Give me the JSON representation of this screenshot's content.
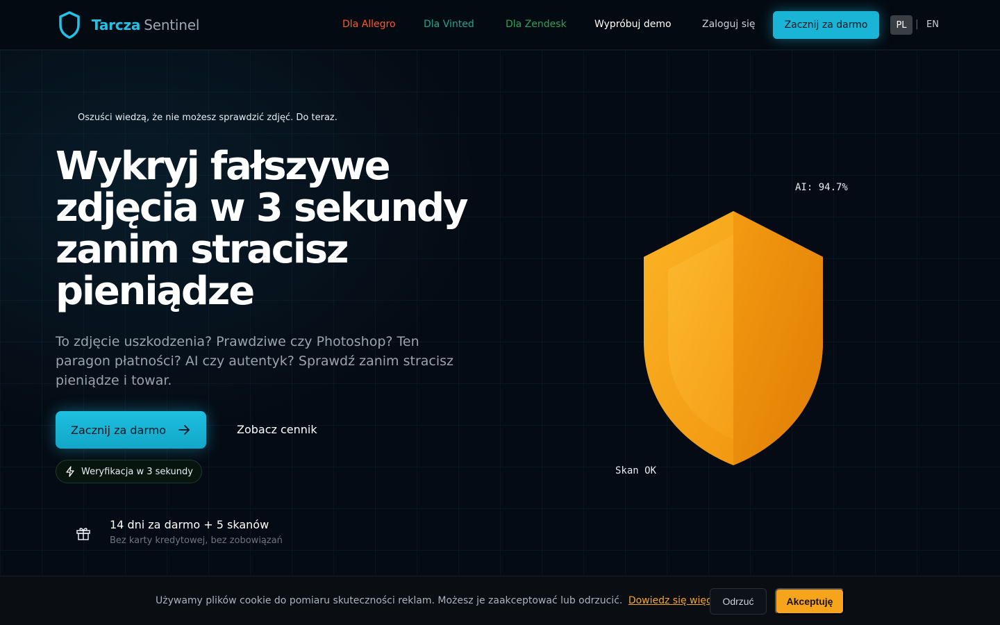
{
  "nav": {
    "brand_primary": "Tarcza",
    "brand_secondary": "Sentinel",
    "links": {
      "allegro": "Dla Allegro",
      "vinted": "Dla Vinted",
      "zendesk": "Dla Zendesk",
      "demo": "Wypróbuj demo",
      "login": "Zaloguj się"
    },
    "cta": "Zacznij za darmo",
    "lang_active": "PL",
    "lang_separator": "|",
    "lang_other": "EN"
  },
  "hero": {
    "tagline": "Oszuści wiedzą, że nie możesz sprawdzić zdjęć. Do teraz.",
    "headline_lines": [
      "Wykryj fałszywe",
      "zdjęcia w 3 sekundy",
      "zanim stracisz",
      "pieniądze"
    ],
    "subtitle": "To zdjęcie uszkodzenia? Prawdziwe czy Photoshop? Ten paragon płatności? AI czy autentyk? Sprawdź zanim stracisz pieniądze i towar.",
    "cta": "Zacznij za darmo",
    "pricing_link": "Zobacz cennik",
    "badge": "Weryfikacja w 3 sekundy",
    "trial_title": "14 dni za darmo + 5 skanów",
    "trial_subtitle": "Bez karty kredytowej, bez zobowiązań"
  },
  "visual": {
    "ai_label": "AI: 94.7%",
    "scan_label": "Skan OK",
    "shield_color": "#f5a41b"
  },
  "cookie": {
    "text": "Używamy plików cookie do pomiaru skuteczności reklam. Możesz je zaakceptować lub odrzucić.",
    "link": "Dowiedz się więcej",
    "reject": "Odrzuć",
    "accept": "Akceptuję"
  },
  "colors": {
    "accent": "#1ab5d6",
    "allegro": "#ff5a1f",
    "vinted": "#1fa68f",
    "zendesk": "#29a35a",
    "cookie_accent": "#f5a623"
  },
  "icons": {
    "logo": "shield-icon",
    "cta_arrow": "arrow-right-icon",
    "badge": "lightning-icon",
    "trial": "gift-icon"
  }
}
